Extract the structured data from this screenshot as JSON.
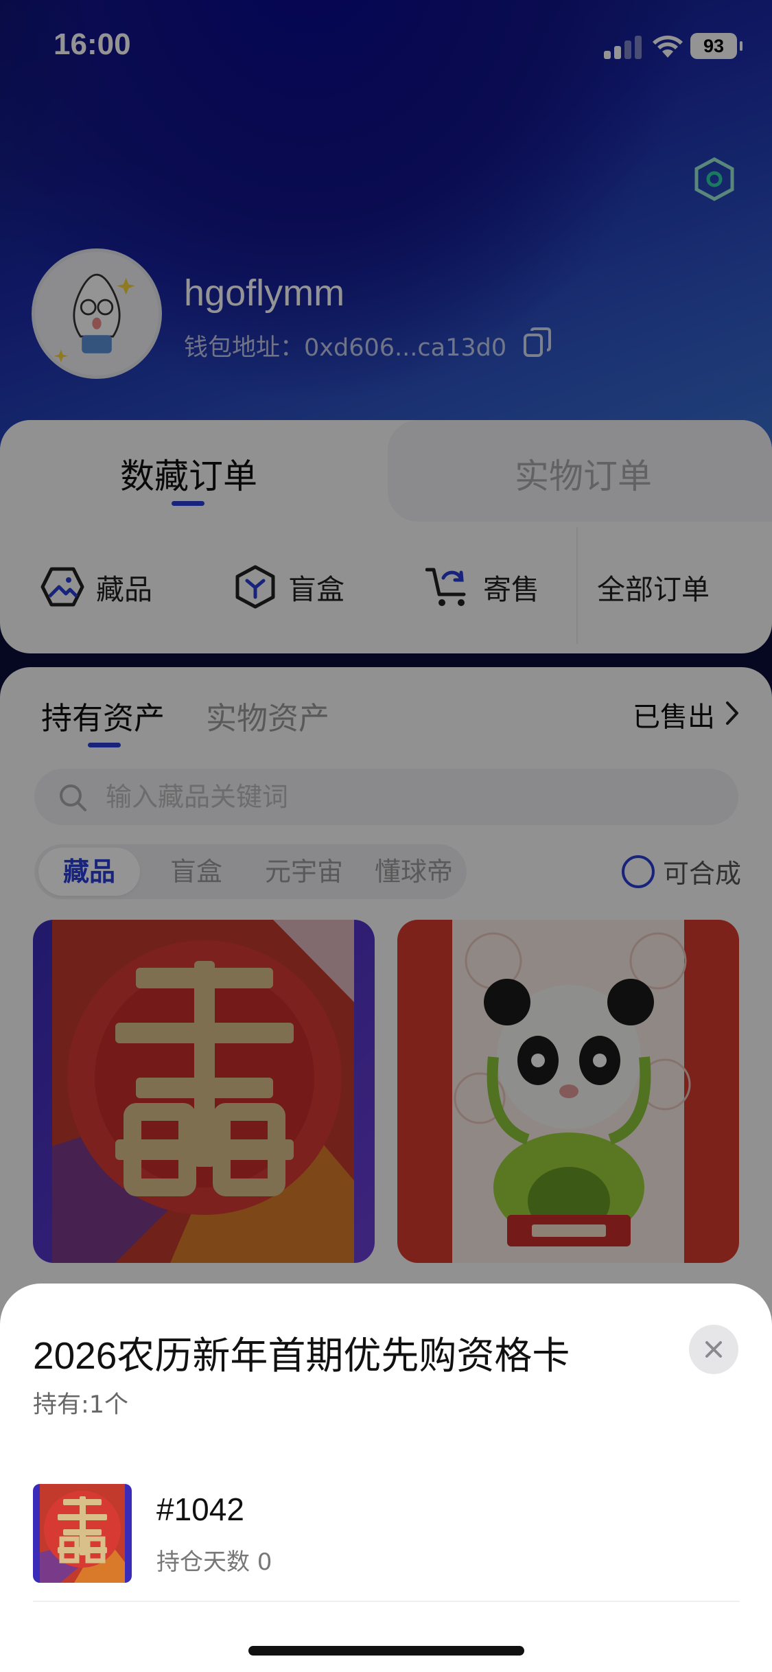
{
  "status_bar": {
    "time": "16:00",
    "battery": "93"
  },
  "profile": {
    "username": "hgoflymm",
    "wallet_label": "钱包地址：",
    "wallet_address": "0xd606...ca13d0"
  },
  "order_tabs": {
    "active": "数藏订单",
    "inactive": "实物订单"
  },
  "order_shortcuts": [
    {
      "label": "藏品",
      "icon": "image-hex-icon"
    },
    {
      "label": "盲盒",
      "icon": "blindbox-hex-icon"
    },
    {
      "label": "寄售",
      "icon": "cart-refresh-icon"
    },
    {
      "label": "全部订单"
    }
  ],
  "asset_tabs": {
    "active": "持有资产",
    "inactive": "实物资产",
    "sold_link": "已售出"
  },
  "search": {
    "placeholder": "输入藏品关键词"
  },
  "filter_chips": [
    "藏品",
    "盲盒",
    "元宇宙",
    "懂球帝"
  ],
  "synth_toggle": "可合成",
  "sheet": {
    "title": "2026农历新年首期优先购资格卡",
    "held": "持有:1个",
    "items": [
      {
        "number": "#1042",
        "hold_days_label": "持仓天数 0"
      }
    ]
  },
  "colors": {
    "accent": "#2a3fd6",
    "hero_dark": "#0d1466",
    "hero_light": "#3c73cf",
    "card_red": "#d8392f"
  }
}
